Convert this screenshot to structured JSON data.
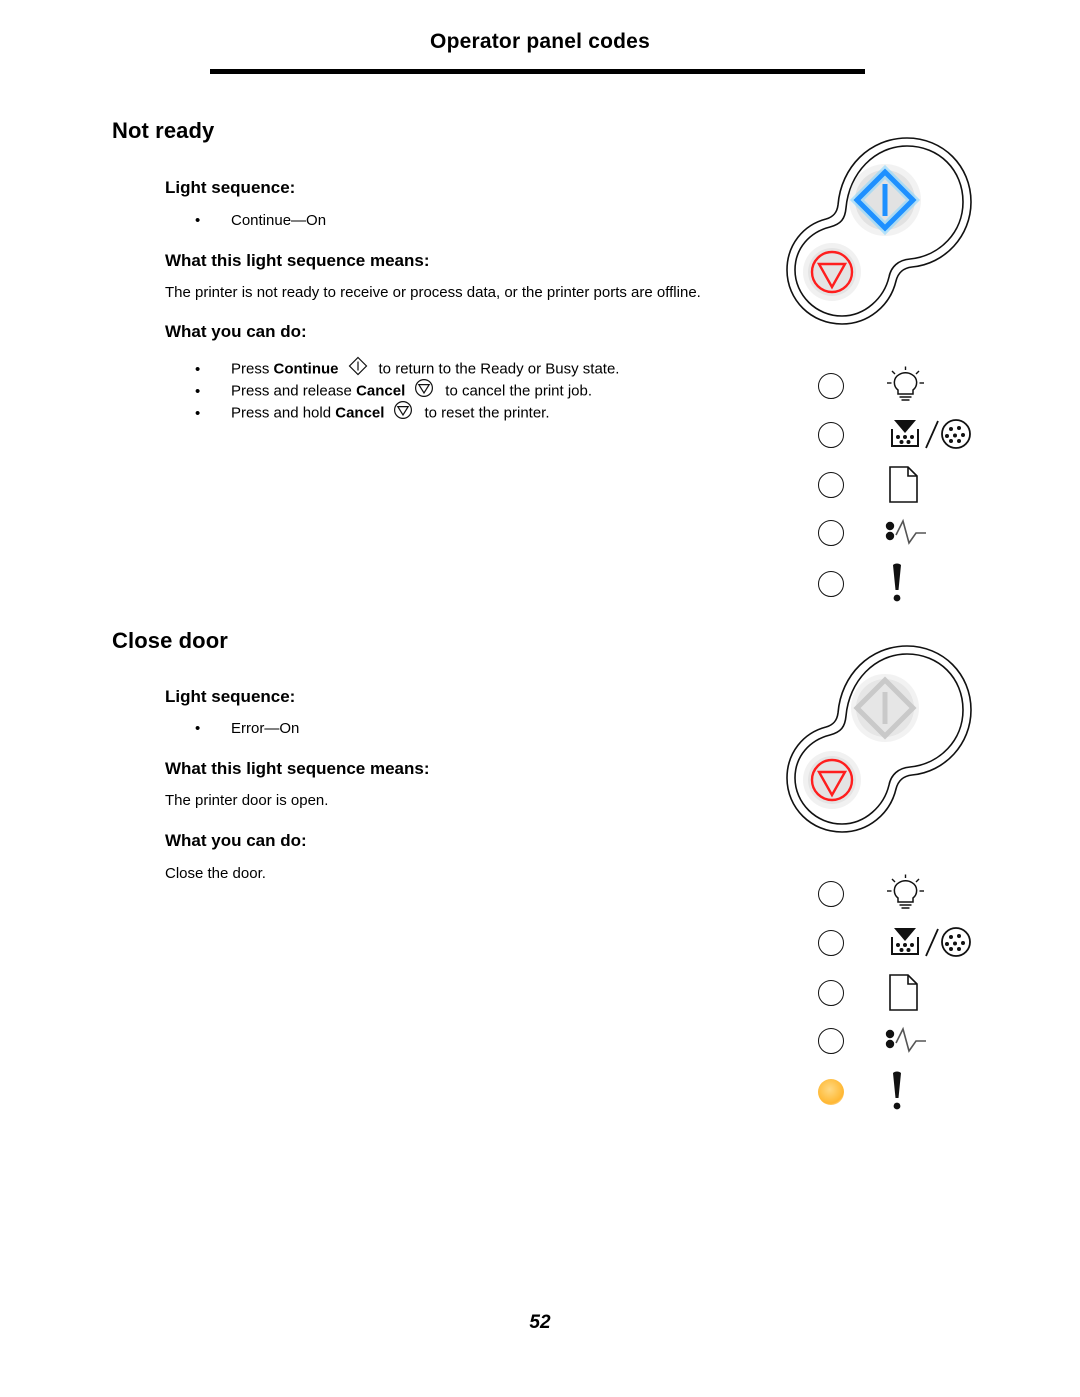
{
  "header": {
    "running_title": "Operator panel codes"
  },
  "folio": {
    "page_number": "52"
  },
  "labels": {
    "light_sequence": "Light sequence:",
    "what_means": "What this light sequence means:",
    "what_you_can_do": "What you can do:",
    "bullet": "•"
  },
  "sections": [
    {
      "title": "Not ready",
      "light_sequence": [
        "Continue—On"
      ],
      "meaning": "The printer is not ready to receive or process data, or the printer ports are offline.",
      "actions": [
        {
          "pre": "Press ",
          "strong": "Continue",
          "icon": "continue-key-icon",
          "post": "to return to the Ready or Busy state."
        },
        {
          "pre": "Press and release ",
          "strong": "Cancel",
          "icon": "cancel-key-icon",
          "post": "to cancel the print job."
        },
        {
          "pre": "Press and hold ",
          "strong": "Cancel",
          "icon": "cancel-key-icon",
          "post": "to reset the printer."
        }
      ],
      "panel": {
        "continue_button_state": "lit",
        "cancel_button_state": "unlit",
        "lights": [
          {
            "name": "ready-light",
            "icon": "lightbulb-icon",
            "state": "off"
          },
          {
            "name": "toner-light",
            "icon": "toner-cartridge-icon",
            "state": "off"
          },
          {
            "name": "load-paper-light",
            "icon": "paper-sheet-icon",
            "state": "off"
          },
          {
            "name": "paper-jam-light",
            "icon": "paper-jam-icon",
            "state": "off"
          },
          {
            "name": "error-light",
            "icon": "exclamation-icon",
            "state": "off"
          }
        ]
      }
    },
    {
      "title": "Close door",
      "light_sequence": [
        "Error—On"
      ],
      "meaning": "The printer door is open.",
      "actions_text": "Close the door.",
      "panel": {
        "continue_button_state": "unlit",
        "cancel_button_state": "unlit",
        "lights": [
          {
            "name": "ready-light",
            "icon": "lightbulb-icon",
            "state": "off"
          },
          {
            "name": "toner-light",
            "icon": "toner-cartridge-icon",
            "state": "off"
          },
          {
            "name": "load-paper-light",
            "icon": "paper-sheet-icon",
            "state": "off"
          },
          {
            "name": "paper-jam-light",
            "icon": "paper-jam-icon",
            "state": "off"
          },
          {
            "name": "error-light",
            "icon": "exclamation-icon",
            "state": "on"
          }
        ]
      }
    }
  ],
  "colors": {
    "continue_lit": "#1E90FF",
    "continue_unlit": "#C8C8C8",
    "cancel_red": "#FF1E1E",
    "error_lit": "#FFC24A",
    "outline": "#111111"
  }
}
